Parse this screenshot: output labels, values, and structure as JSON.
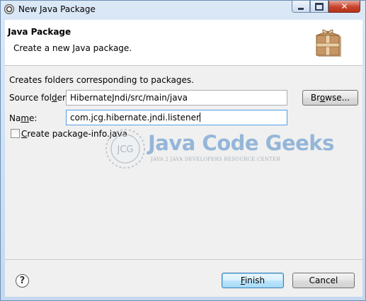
{
  "window": {
    "title": "New Java Package"
  },
  "header": {
    "title": "Java Package",
    "subtitle": "Create a new Java package."
  },
  "form": {
    "description": "Creates folders corresponding to packages.",
    "source_folder": {
      "label_pre": "Source fol",
      "label_mn": "d",
      "label_post": "er:",
      "value": "HibernateJndi/src/main/java"
    },
    "browse_button": {
      "label_pre": "Br",
      "label_mn": "o",
      "label_post": "wse..."
    },
    "name": {
      "label_pre": "Na",
      "label_mn": "m",
      "label_post": "e:",
      "value": "com.jcg.hibernate.jndi.listener"
    },
    "package_info": {
      "label_mn": "C",
      "label_post": "reate package-info.java",
      "checked": false
    }
  },
  "watermark": {
    "logo_text": "JCG",
    "name": "Java Code Geeks",
    "tagline": "JAVA 2 JAVA DEVELOPERS RESOURCE CENTER"
  },
  "footer": {
    "finish_button": {
      "label_mn": "F",
      "label_post": "inish"
    },
    "cancel_button": {
      "label": "Cancel"
    }
  },
  "icons": [
    "eclipse-app-icon",
    "package-icon",
    "help-icon",
    "minimize-icon",
    "maximize-icon",
    "close-icon"
  ],
  "colors": {
    "accent": "#3c7fb1",
    "watermark_blue": "#4a88c8",
    "close_red": "#c7432b"
  }
}
